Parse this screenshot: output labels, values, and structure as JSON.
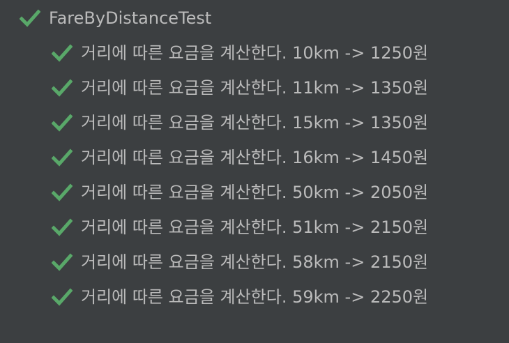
{
  "suite": {
    "name": "FareByDistanceTest",
    "status_icon": "check-icon",
    "status_color": "#59a869"
  },
  "tests": [
    {
      "label": "거리에 따른 요금을 계산한다. 10km -> 1250원"
    },
    {
      "label": "거리에 따른 요금을 계산한다. 11km -> 1350원"
    },
    {
      "label": "거리에 따른 요금을 계산한다. 15km -> 1350원"
    },
    {
      "label": "거리에 따른 요금을 계산한다. 16km -> 1450원"
    },
    {
      "label": "거리에 따른 요금을 계산한다. 50km -> 2050원"
    },
    {
      "label": "거리에 따른 요금을 계산한다. 51km -> 2150원"
    },
    {
      "label": "거리에 따른 요금을 계산한다. 58km -> 2150원"
    },
    {
      "label": "거리에 따른 요금을 계산한다. 59km -> 2250원"
    }
  ]
}
